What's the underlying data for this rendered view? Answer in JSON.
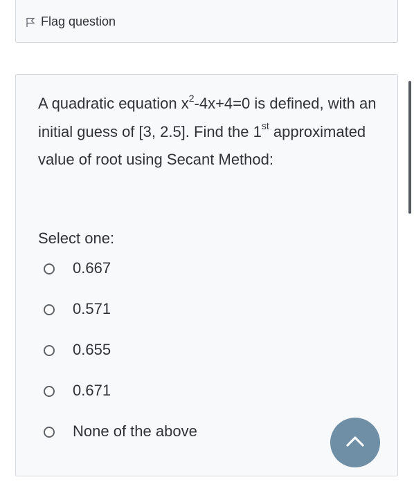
{
  "flag": {
    "label": "Flag question",
    "icon": "flag-outline-icon"
  },
  "question": {
    "text_part1": "A quadratic equation x",
    "superscript1": "2",
    "text_part2": "-4x+4=0 is defined, with an initial guess of [3, 2.5]. Find the 1",
    "superscript2": "st",
    "text_part3": " approximated value of root using Secant Method:",
    "select_one_label": "Select one:",
    "options": [
      {
        "label": "0.667"
      },
      {
        "label": "0.571"
      },
      {
        "label": "0.655"
      },
      {
        "label": "0.671"
      },
      {
        "label": "None of the above"
      }
    ]
  },
  "scroll_top_button": {
    "icon": "chevron-up-icon",
    "color": "#6e8fa6"
  }
}
